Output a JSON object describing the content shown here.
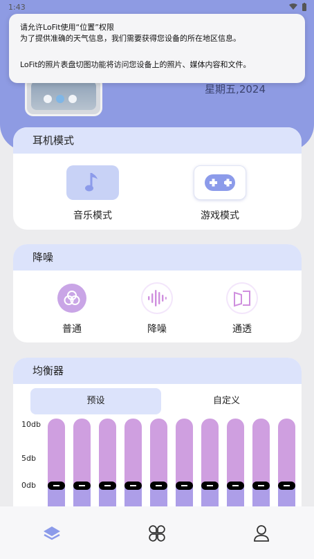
{
  "status_bar": {
    "time": "1:43"
  },
  "permission": {
    "title": "请允许LoFit使用“位置”权限",
    "body": "为了提供准确的天气信息，我们需要获得您设备的所在地区信息。",
    "photo_note": "LoFit的照片表盘切图功能将访问您设备上的照片、媒体内容和文件。"
  },
  "header": {
    "date": "星期五,2024"
  },
  "earphone": {
    "title": "耳机模式",
    "modes": [
      {
        "label": "音乐模式",
        "icon": "music-note-icon"
      },
      {
        "label": "游戏模式",
        "icon": "gamepad-icon"
      }
    ]
  },
  "noise": {
    "title": "降噪",
    "options": [
      {
        "label": "普通",
        "icon": "normal-mode-icon"
      },
      {
        "label": "降噪",
        "icon": "noise-reduction-icon"
      },
      {
        "label": "通透",
        "icon": "transparency-icon"
      }
    ]
  },
  "equalizer": {
    "title": "均衡器",
    "tabs": [
      "预设",
      "自定义"
    ],
    "axis": [
      "10db",
      "5db",
      "0db"
    ],
    "band_levels_db": [
      0,
      0,
      0,
      0,
      0,
      0,
      0,
      0,
      0,
      0
    ]
  },
  "nav": {
    "items": [
      "home-icon",
      "apps-icon",
      "profile-icon"
    ]
  },
  "colors": {
    "header": "#8e9be3",
    "card_head": "#dce3fb",
    "eq_upper": "#cf9fe0",
    "eq_lower": "#ad9ee8",
    "accent": "#c9a5e6"
  }
}
